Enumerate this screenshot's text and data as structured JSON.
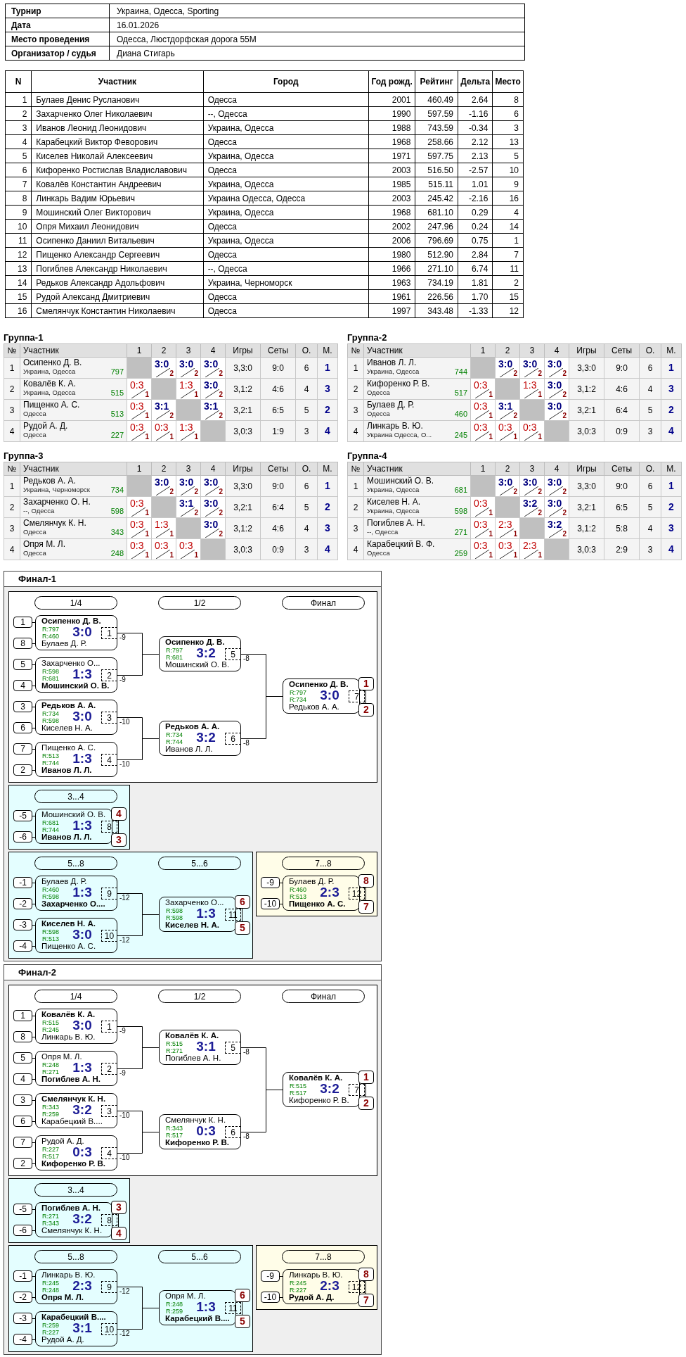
{
  "info": [
    {
      "label": "Турнир",
      "value": "Украина, Одесса, Sporting"
    },
    {
      "label": "Дата",
      "value": "16.01.2026"
    },
    {
      "label": "Место проведения",
      "value": "Одесса, Люстдорфская дорога 55М"
    },
    {
      "label": "Организатор / судья",
      "value": "Диана Стигарь"
    }
  ],
  "players_table": {
    "columns": [
      "N",
      "Участник",
      "Город",
      "Год рожд.",
      "Рейтинг",
      "Дельта",
      "Место"
    ],
    "rows": [
      [
        "1",
        "Булаев Денис Русланович",
        "Одесса",
        "2001",
        "460.49",
        "2.64",
        "8"
      ],
      [
        "2",
        "Захарченко Олег Николаевич",
        "--, Одесса",
        "1990",
        "597.59",
        "-1.16",
        "6"
      ],
      [
        "3",
        "Иванов Леонид Леонидович",
        "Украина, Одесса",
        "1988",
        "743.59",
        "-0.34",
        "3"
      ],
      [
        "4",
        "Карабецкий Виктор Феворович",
        "Одесса",
        "1968",
        "258.66",
        "2.12",
        "13"
      ],
      [
        "5",
        "Киселев Николай Алексеевич",
        "Украина, Одесса",
        "1971",
        "597.75",
        "2.13",
        "5"
      ],
      [
        "6",
        "Кифоренко Ростислав Владиславович",
        "Одесса",
        "2003",
        "516.50",
        "-2.57",
        "10"
      ],
      [
        "7",
        "Ковалёв Константин Андреевич",
        "Украина, Одесса",
        "1985",
        "515.11",
        "1.01",
        "9"
      ],
      [
        "8",
        "Линкарь Вадим Юрьевич",
        "Украина Одесса, Одесса",
        "2003",
        "245.42",
        "-2.16",
        "16"
      ],
      [
        "9",
        "Мошинский Олег Викторович",
        "Украина, Одесса",
        "1968",
        "681.10",
        "0.29",
        "4"
      ],
      [
        "10",
        "Опря Михаил Леонидович",
        "Одесса",
        "2002",
        "247.96",
        "0.24",
        "14"
      ],
      [
        "11",
        "Осипенко Даниил Витальевич",
        "Украина, Одесса",
        "2006",
        "796.69",
        "0.75",
        "1"
      ],
      [
        "12",
        "Пищенко Александр Сергеевич",
        "Одесса",
        "1980",
        "512.90",
        "2.84",
        "7"
      ],
      [
        "13",
        "Погиблев Александр Николаевич",
        "--, Одесса",
        "1966",
        "271.10",
        "6.74",
        "11"
      ],
      [
        "14",
        "Редьков Александр Адольфович",
        "Украина, Черноморск",
        "1963",
        "734.19",
        "1.81",
        "2"
      ],
      [
        "15",
        "Рудой Александ Дмитриевич",
        "Одесса",
        "1961",
        "226.56",
        "1.70",
        "15"
      ],
      [
        "16",
        "Смелянчук Константин Николаевич",
        "Одесса",
        "1997",
        "343.48",
        "-1.33",
        "12"
      ]
    ]
  },
  "groups": [
    {
      "title": "Группа-1",
      "columns": [
        "№",
        "Участник",
        "1",
        "2",
        "3",
        "4",
        "Игры",
        "Сеты",
        "О.",
        "М."
      ],
      "rows": [
        {
          "number": "1",
          "name": "Осипенко Д. В.",
          "city": "Украина, Одесса",
          "rating": "797",
          "results": [
            {
              "kind": "self"
            },
            {
              "kind": "win",
              "score": "3:0",
              "points": "2"
            },
            {
              "kind": "win",
              "score": "3:0",
              "points": "2"
            },
            {
              "kind": "win",
              "score": "3:0",
              "points": "2"
            }
          ],
          "games": "3,3:0",
          "sets": "9:0",
          "points": "6",
          "place": "1"
        },
        {
          "number": "2",
          "name": "Ковалёв К. А.",
          "city": "Украина, Одесса",
          "rating": "515",
          "results": [
            {
              "kind": "loss",
              "score": "0:3",
              "points": "1"
            },
            {
              "kind": "self"
            },
            {
              "kind": "loss",
              "score": "1:3",
              "points": "1"
            },
            {
              "kind": "win",
              "score": "3:0",
              "points": "2"
            }
          ],
          "games": "3,1:2",
          "sets": "4:6",
          "points": "4",
          "place": "3"
        },
        {
          "number": "3",
          "name": "Пищенко А. С.",
          "city": "Одесса",
          "rating": "513",
          "results": [
            {
              "kind": "loss",
              "score": "0:3",
              "points": "1"
            },
            {
              "kind": "win",
              "score": "3:1",
              "points": "2"
            },
            {
              "kind": "self"
            },
            {
              "kind": "win",
              "score": "3:1",
              "points": "2"
            }
          ],
          "games": "3,2:1",
          "sets": "6:5",
          "points": "5",
          "place": "2"
        },
        {
          "number": "4",
          "name": "Рудой А. Д.",
          "city": "Одесса",
          "rating": "227",
          "results": [
            {
              "kind": "loss",
              "score": "0:3",
              "points": "1"
            },
            {
              "kind": "loss",
              "score": "0:3",
              "points": "1"
            },
            {
              "kind": "loss",
              "score": "1:3",
              "points": "1"
            },
            {
              "kind": "self"
            }
          ],
          "games": "3,0:3",
          "sets": "1:9",
          "points": "3",
          "place": "4"
        }
      ]
    },
    {
      "title": "Группа-2",
      "columns": [
        "№",
        "Участник",
        "1",
        "2",
        "3",
        "4",
        "Игры",
        "Сеты",
        "О.",
        "М."
      ],
      "rows": [
        {
          "number": "1",
          "name": "Иванов Л. Л.",
          "city": "Украина, Одесса",
          "rating": "744",
          "results": [
            {
              "kind": "self"
            },
            {
              "kind": "win",
              "score": "3:0",
              "points": "2"
            },
            {
              "kind": "win",
              "score": "3:0",
              "points": "2"
            },
            {
              "kind": "win",
              "score": "3:0",
              "points": "2"
            }
          ],
          "games": "3,3:0",
          "sets": "9:0",
          "points": "6",
          "place": "1"
        },
        {
          "number": "2",
          "name": "Кифоренко Р. В.",
          "city": "Одесса",
          "rating": "517",
          "results": [
            {
              "kind": "loss",
              "score": "0:3",
              "points": "1"
            },
            {
              "kind": "self"
            },
            {
              "kind": "loss",
              "score": "1:3",
              "points": "1"
            },
            {
              "kind": "win",
              "score": "3:0",
              "points": "2"
            }
          ],
          "games": "3,1:2",
          "sets": "4:6",
          "points": "4",
          "place": "3"
        },
        {
          "number": "3",
          "name": "Булаев Д. Р.",
          "city": "Одесса",
          "rating": "460",
          "results": [
            {
              "kind": "loss",
              "score": "0:3",
              "points": "1"
            },
            {
              "kind": "win",
              "score": "3:1",
              "points": "2"
            },
            {
              "kind": "self"
            },
            {
              "kind": "win",
              "score": "3:0",
              "points": "2"
            }
          ],
          "games": "3,2:1",
          "sets": "6:4",
          "points": "5",
          "place": "2"
        },
        {
          "number": "4",
          "name": "Линкарь В. Ю.",
          "city": "Украина Одесса, О...",
          "rating": "245",
          "results": [
            {
              "kind": "loss",
              "score": "0:3",
              "points": "1"
            },
            {
              "kind": "loss",
              "score": "0:3",
              "points": "1"
            },
            {
              "kind": "loss",
              "score": "0:3",
              "points": "1"
            },
            {
              "kind": "self"
            }
          ],
          "games": "3,0:3",
          "sets": "0:9",
          "points": "3",
          "place": "4"
        }
      ]
    },
    {
      "title": "Группа-3",
      "columns": [
        "№",
        "Участник",
        "1",
        "2",
        "3",
        "4",
        "Игры",
        "Сеты",
        "О.",
        "М."
      ],
      "rows": [
        {
          "number": "1",
          "name": "Редьков А. А.",
          "city": "Украина, Черноморск",
          "rating": "734",
          "results": [
            {
              "kind": "self"
            },
            {
              "kind": "win",
              "score": "3:0",
              "points": "2"
            },
            {
              "kind": "win",
              "score": "3:0",
              "points": "2"
            },
            {
              "kind": "win",
              "score": "3:0",
              "points": "2"
            }
          ],
          "games": "3,3:0",
          "sets": "9:0",
          "points": "6",
          "place": "1"
        },
        {
          "number": "2",
          "name": "Захарченко О. Н.",
          "city": "--, Одесса",
          "rating": "598",
          "results": [
            {
              "kind": "loss",
              "score": "0:3",
              "points": "1"
            },
            {
              "kind": "self"
            },
            {
              "kind": "win",
              "score": "3:1",
              "points": "2"
            },
            {
              "kind": "win",
              "score": "3:0",
              "points": "2"
            }
          ],
          "games": "3,2:1",
          "sets": "6:4",
          "points": "5",
          "place": "2"
        },
        {
          "number": "3",
          "name": "Смелянчук К. Н.",
          "city": "Одесса",
          "rating": "343",
          "results": [
            {
              "kind": "loss",
              "score": "0:3",
              "points": "1"
            },
            {
              "kind": "loss",
              "score": "1:3",
              "points": "1"
            },
            {
              "kind": "self"
            },
            {
              "kind": "win",
              "score": "3:0",
              "points": "2"
            }
          ],
          "games": "3,1:2",
          "sets": "4:6",
          "points": "4",
          "place": "3"
        },
        {
          "number": "4",
          "name": "Опря М. Л.",
          "city": "Одесса",
          "rating": "248",
          "results": [
            {
              "kind": "loss",
              "score": "0:3",
              "points": "1"
            },
            {
              "kind": "loss",
              "score": "0:3",
              "points": "1"
            },
            {
              "kind": "loss",
              "score": "0:3",
              "points": "1"
            },
            {
              "kind": "self"
            }
          ],
          "games": "3,0:3",
          "sets": "0:9",
          "points": "3",
          "place": "4"
        }
      ]
    },
    {
      "title": "Группа-4",
      "columns": [
        "№",
        "Участник",
        "1",
        "2",
        "3",
        "4",
        "Игры",
        "Сеты",
        "О.",
        "М."
      ],
      "rows": [
        {
          "number": "1",
          "name": "Мошинский О. В.",
          "city": "Украина, Одесса",
          "rating": "681",
          "results": [
            {
              "kind": "self"
            },
            {
              "kind": "win",
              "score": "3:0",
              "points": "2"
            },
            {
              "kind": "win",
              "score": "3:0",
              "points": "2"
            },
            {
              "kind": "win",
              "score": "3:0",
              "points": "2"
            }
          ],
          "games": "3,3:0",
          "sets": "9:0",
          "points": "6",
          "place": "1"
        },
        {
          "number": "2",
          "name": "Киселев Н. А.",
          "city": "Украина, Одесса",
          "rating": "598",
          "results": [
            {
              "kind": "loss",
              "score": "0:3",
              "points": "1"
            },
            {
              "kind": "self"
            },
            {
              "kind": "win",
              "score": "3:2",
              "points": "2"
            },
            {
              "kind": "win",
              "score": "3:0",
              "points": "2"
            }
          ],
          "games": "3,2:1",
          "sets": "6:5",
          "points": "5",
          "place": "2"
        },
        {
          "number": "3",
          "name": "Погиблев А. Н.",
          "city": "--, Одесса",
          "rating": "271",
          "results": [
            {
              "kind": "loss",
              "score": "0:3",
              "points": "1"
            },
            {
              "kind": "loss",
              "score": "2:3",
              "points": "1"
            },
            {
              "kind": "self"
            },
            {
              "kind": "win",
              "score": "3:2",
              "points": "2"
            }
          ],
          "games": "3,1:2",
          "sets": "5:8",
          "points": "4",
          "place": "3"
        },
        {
          "number": "4",
          "name": "Карабецкий В. Ф.",
          "city": "Одесса",
          "rating": "259",
          "results": [
            {
              "kind": "loss",
              "score": "0:3",
              "points": "1"
            },
            {
              "kind": "loss",
              "score": "0:3",
              "points": "1"
            },
            {
              "kind": "loss",
              "score": "2:3",
              "points": "1"
            },
            {
              "kind": "self"
            }
          ],
          "games": "3,0:3",
          "sets": "2:9",
          "points": "3",
          "place": "4"
        }
      ]
    }
  ],
  "finals": [
    {
      "title": "Финал-1",
      "panels": [
        {
          "color": "#ffffff",
          "rounds": [
            {
              "label": "1/4",
              "matches": [
                {
                  "seeds": [
                    "1",
                    "8"
                  ],
                  "players": [
                    {
                      "name": "Осипенко Д. В.",
                      "rating": "R:797",
                      "winner": true
                    },
                    {
                      "name": "Булаев Д. Р.",
                      "rating": "R:460",
                      "winner": false
                    }
                  ],
                  "score": "3:0",
                  "number": "1",
                  "next": "-9"
                },
                {
                  "seeds": [
                    "5",
                    "4"
                  ],
                  "players": [
                    {
                      "name": "Захарченко О...",
                      "rating": "R:598",
                      "winner": false
                    },
                    {
                      "name": "Мошинский О. В.",
                      "rating": "R:681",
                      "winner": true
                    }
                  ],
                  "score": "1:3",
                  "number": "2",
                  "next": "-9"
                },
                {
                  "seeds": [
                    "3",
                    "6"
                  ],
                  "players": [
                    {
                      "name": "Редьков А. А.",
                      "rating": "R:734",
                      "winner": true
                    },
                    {
                      "name": "Киселев Н. А.",
                      "rating": "R:598",
                      "winner": false
                    }
                  ],
                  "score": "3:0",
                  "number": "3",
                  "next": "-10"
                },
                {
                  "seeds": [
                    "7",
                    "2"
                  ],
                  "players": [
                    {
                      "name": "Пищенко А. С.",
                      "rating": "R:513",
                      "winner": false
                    },
                    {
                      "name": "Иванов Л. Л.",
                      "rating": "R:744",
                      "winner": true
                    }
                  ],
                  "score": "1:3",
                  "number": "4",
                  "next": "-10"
                }
              ]
            },
            {
              "label": "1/2",
              "matches": [
                {
                  "players": [
                    {
                      "name": "Осипенко Д. В.",
                      "rating": "R:797",
                      "winner": true
                    },
                    {
                      "name": "Мошинский О. В.",
                      "rating": "R:681",
                      "winner": false
                    }
                  ],
                  "score": "3:2",
                  "number": "5",
                  "next": "-8"
                },
                {
                  "players": [
                    {
                      "name": "Редьков А. А.",
                      "rating": "R:734",
                      "winner": true
                    },
                    {
                      "name": "Иванов Л. Л.",
                      "rating": "R:744",
                      "winner": false
                    }
                  ],
                  "score": "3:2",
                  "number": "6",
                  "next": "-8"
                }
              ]
            },
            {
              "label": "Финал",
              "matches": [
                {
                  "players": [
                    {
                      "name": "Осипенко Д. В.",
                      "rating": "R:797",
                      "winner": true
                    },
                    {
                      "name": "Редьков А. А.",
                      "rating": "R:734",
                      "winner": false
                    }
                  ],
                  "score": "3:0",
                  "number": "7",
                  "places": [
                    "1",
                    "2"
                  ]
                }
              ]
            }
          ]
        },
        {
          "color": "#e4feff",
          "rounds": [
            {
              "label": "3...4",
              "matches": [
                {
                  "seeds": [
                    "-5",
                    "-6"
                  ],
                  "players": [
                    {
                      "name": "Мошинский О. В.",
                      "rating": "R:681",
                      "winner": false
                    },
                    {
                      "name": "Иванов Л. Л.",
                      "rating": "R:744",
                      "winner": true
                    }
                  ],
                  "score": "1:3",
                  "number": "8",
                  "places": [
                    "4",
                    "3"
                  ]
                }
              ]
            }
          ]
        },
        {
          "color": "#e4feff",
          "rounds": [
            {
              "label": "5...8",
              "matches": [
                {
                  "seeds": [
                    "-1",
                    "-2"
                  ],
                  "players": [
                    {
                      "name": "Булаев Д. Р.",
                      "rating": "R:460",
                      "winner": false
                    },
                    {
                      "name": "Захарченко О....",
                      "rating": "R:598",
                      "winner": true
                    }
                  ],
                  "score": "1:3",
                  "number": "9",
                  "next": "-12"
                },
                {
                  "seeds": [
                    "-3",
                    "-4"
                  ],
                  "players": [
                    {
                      "name": "Киселев Н. А.",
                      "rating": "R:598",
                      "winner": true
                    },
                    {
                      "name": "Пищенко А. С.",
                      "rating": "R:513",
                      "winner": false
                    }
                  ],
                  "score": "3:0",
                  "number": "10",
                  "next": "-12"
                }
              ]
            },
            {
              "label": "5...6",
              "matches": [
                {
                  "players": [
                    {
                      "name": "Захарченко О...",
                      "rating": "R:598",
                      "winner": false
                    },
                    {
                      "name": "Киселев Н. А.",
                      "rating": "R:598",
                      "winner": true
                    }
                  ],
                  "score": "1:3",
                  "number": "11",
                  "places": [
                    "6",
                    "5"
                  ]
                }
              ]
            }
          ]
        },
        {
          "color": "#fffde8",
          "rounds": [
            {
              "label": "7...8",
              "matches": [
                {
                  "seeds": [
                    "-9",
                    "-10"
                  ],
                  "players": [
                    {
                      "name": "Булаев Д. Р.",
                      "rating": "R:460",
                      "winner": false
                    },
                    {
                      "name": "Пищенко А. С.",
                      "rating": "R:513",
                      "winner": true
                    }
                  ],
                  "score": "2:3",
                  "number": "12",
                  "places": [
                    "8",
                    "7"
                  ]
                }
              ]
            }
          ]
        }
      ]
    },
    {
      "title": "Финал-2",
      "panels": [
        {
          "color": "#ffffff",
          "rounds": [
            {
              "label": "1/4",
              "matches": [
                {
                  "seeds": [
                    "1",
                    "8"
                  ],
                  "players": [
                    {
                      "name": "Ковалёв К. А.",
                      "rating": "R:515",
                      "winner": true
                    },
                    {
                      "name": "Линкарь В. Ю.",
                      "rating": "R:245",
                      "winner": false
                    }
                  ],
                  "score": "3:0",
                  "number": "1",
                  "next": "-9"
                },
                {
                  "seeds": [
                    "5",
                    "4"
                  ],
                  "players": [
                    {
                      "name": "Опря М. Л.",
                      "rating": "R:248",
                      "winner": false
                    },
                    {
                      "name": "Погиблев А. Н.",
                      "rating": "R:271",
                      "winner": true
                    }
                  ],
                  "score": "1:3",
                  "number": "2",
                  "next": "-9"
                },
                {
                  "seeds": [
                    "3",
                    "6"
                  ],
                  "players": [
                    {
                      "name": "Смелянчук К. Н.",
                      "rating": "R:343",
                      "winner": true
                    },
                    {
                      "name": "Карабецкий В....",
                      "rating": "R:259",
                      "winner": false
                    }
                  ],
                  "score": "3:2",
                  "number": "3",
                  "next": "-10"
                },
                {
                  "seeds": [
                    "7",
                    "2"
                  ],
                  "players": [
                    {
                      "name": "Рудой А. Д.",
                      "rating": "R:227",
                      "winner": false
                    },
                    {
                      "name": "Кифоренко Р. В.",
                      "rating": "R:517",
                      "winner": true
                    }
                  ],
                  "score": "0:3",
                  "number": "4",
                  "next": "-10"
                }
              ]
            },
            {
              "label": "1/2",
              "matches": [
                {
                  "players": [
                    {
                      "name": "Ковалёв К. А.",
                      "rating": "R:515",
                      "winner": true
                    },
                    {
                      "name": "Погиблев А. Н.",
                      "rating": "R:271",
                      "winner": false
                    }
                  ],
                  "score": "3:1",
                  "number": "5",
                  "next": "-8"
                },
                {
                  "players": [
                    {
                      "name": "Смелянчук К. Н.",
                      "rating": "R:343",
                      "winner": false
                    },
                    {
                      "name": "Кифоренко Р. В.",
                      "rating": "R:517",
                      "winner": true
                    }
                  ],
                  "score": "0:3",
                  "number": "6",
                  "next": "-8"
                }
              ]
            },
            {
              "label": "Финал",
              "matches": [
                {
                  "players": [
                    {
                      "name": "Ковалёв К. А.",
                      "rating": "R:515",
                      "winner": true
                    },
                    {
                      "name": "Кифоренко Р. В.",
                      "rating": "R:517",
                      "winner": false
                    }
                  ],
                  "score": "3:2",
                  "number": "7",
                  "places": [
                    "1",
                    "2"
                  ]
                }
              ]
            }
          ]
        },
        {
          "color": "#e4feff",
          "rounds": [
            {
              "label": "3...4",
              "matches": [
                {
                  "seeds": [
                    "-5",
                    "-6"
                  ],
                  "players": [
                    {
                      "name": "Погиблев А. Н.",
                      "rating": "R:271",
                      "winner": true
                    },
                    {
                      "name": "Смелянчук К. Н.",
                      "rating": "R:343",
                      "winner": false
                    }
                  ],
                  "score": "3:2",
                  "number": "8",
                  "places": [
                    "3",
                    "4"
                  ]
                }
              ]
            }
          ]
        },
        {
          "color": "#e4feff",
          "rounds": [
            {
              "label": "5...8",
              "matches": [
                {
                  "seeds": [
                    "-1",
                    "-2"
                  ],
                  "players": [
                    {
                      "name": "Линкарь В. Ю.",
                      "rating": "R:245",
                      "winner": false
                    },
                    {
                      "name": "Опря М. Л.",
                      "rating": "R:248",
                      "winner": true
                    }
                  ],
                  "score": "2:3",
                  "number": "9",
                  "next": "-12"
                },
                {
                  "seeds": [
                    "-3",
                    "-4"
                  ],
                  "players": [
                    {
                      "name": "Карабецкий В....",
                      "rating": "R:259",
                      "winner": true
                    },
                    {
                      "name": "Рудой А. Д.",
                      "rating": "R:227",
                      "winner": false
                    }
                  ],
                  "score": "3:1",
                  "number": "10",
                  "next": "-12"
                }
              ]
            },
            {
              "label": "5...6",
              "matches": [
                {
                  "players": [
                    {
                      "name": "Опря М. Л.",
                      "rating": "R:248",
                      "winner": false
                    },
                    {
                      "name": "Карабецкий В....",
                      "rating": "R:259",
                      "winner": true
                    }
                  ],
                  "score": "1:3",
                  "number": "11",
                  "places": [
                    "6",
                    "5"
                  ]
                }
              ]
            }
          ]
        },
        {
          "color": "#fffde8",
          "rounds": [
            {
              "label": "7...8",
              "matches": [
                {
                  "seeds": [
                    "-9",
                    "-10"
                  ],
                  "players": [
                    {
                      "name": "Линкарь В. Ю.",
                      "rating": "R:245",
                      "winner": false
                    },
                    {
                      "name": "Рудой А. Д.",
                      "rating": "R:227",
                      "winner": true
                    }
                  ],
                  "score": "2:3",
                  "number": "12",
                  "places": [
                    "8",
                    "7"
                  ]
                }
              ]
            }
          ]
        }
      ]
    }
  ]
}
